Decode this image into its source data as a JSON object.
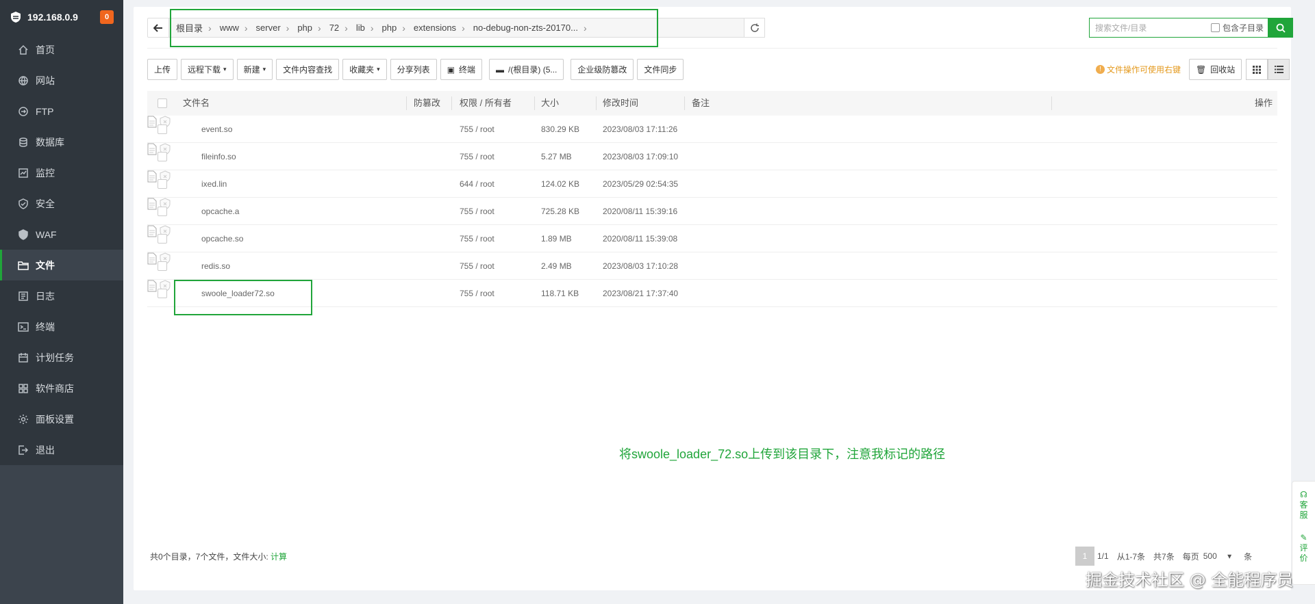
{
  "sidebar": {
    "server_ip": "192.168.0.9",
    "badge_count": "0",
    "items": [
      {
        "label": "首页"
      },
      {
        "label": "网站"
      },
      {
        "label": "FTP"
      },
      {
        "label": "数据库"
      },
      {
        "label": "监控"
      },
      {
        "label": "安全"
      },
      {
        "label": "WAF"
      },
      {
        "label": "文件"
      },
      {
        "label": "日志"
      },
      {
        "label": "终端"
      },
      {
        "label": "计划任务"
      },
      {
        "label": "软件商店"
      },
      {
        "label": "面板设置"
      },
      {
        "label": "退出"
      }
    ],
    "active": "文件"
  },
  "path": {
    "crumbs": [
      "根目录",
      "www",
      "server",
      "php",
      "72",
      "lib",
      "php",
      "extensions",
      "no-debug-non-zts-20170..."
    ]
  },
  "search": {
    "placeholder": "搜索文件/目录",
    "subdir_label": "包含子目录"
  },
  "toolbar": {
    "upload": "上传",
    "remote_download": "远程下载",
    "new": "新建",
    "content_search": "文件内容查找",
    "favorites": "收藏夹",
    "share_list": "分享列表",
    "terminal": "终端",
    "disk": "/(根目录) (5...",
    "tamper_proof": "企业级防篡改",
    "file_sync": "文件同步",
    "tip": "文件操作可使用右键",
    "recycle": "回收站"
  },
  "table": {
    "headers": {
      "name": "文件名",
      "tamper": "防篡改",
      "perm": "权限 / 所有者",
      "size": "大小",
      "mtime": "修改时间",
      "remark": "备注",
      "action": "操作"
    },
    "rows": [
      {
        "name": "event.so",
        "perm": "755 / root",
        "size": "830.29 KB",
        "mtime": "2023/08/03 17:11:26"
      },
      {
        "name": "fileinfo.so",
        "perm": "755 / root",
        "size": "5.27 MB",
        "mtime": "2023/08/03 17:09:10"
      },
      {
        "name": "ixed.lin",
        "perm": "644 / root",
        "size": "124.02 KB",
        "mtime": "2023/05/29 02:54:35"
      },
      {
        "name": "opcache.a",
        "perm": "755 / root",
        "size": "725.28 KB",
        "mtime": "2020/08/11 15:39:16"
      },
      {
        "name": "opcache.so",
        "perm": "755 / root",
        "size": "1.89 MB",
        "mtime": "2020/08/11 15:39:08"
      },
      {
        "name": "redis.so",
        "perm": "755 / root",
        "size": "2.49 MB",
        "mtime": "2023/08/03 17:10:28"
      },
      {
        "name": "swoole_loader72.so",
        "perm": "755 / root",
        "size": "118.71 KB",
        "mtime": "2023/08/21 17:37:40"
      }
    ]
  },
  "annotation": "将swoole_loader_72.so上传到该目录下，注意我标记的路径",
  "footer": {
    "summary": "共0个目录，7个文件，文件大小: ",
    "calc": "计算",
    "page_current": "1",
    "page_total": "1/1",
    "range": "从1-7条",
    "total": "共7条",
    "per_page_label": "每页",
    "per_page_value": "500",
    "unit": "条"
  },
  "float_widget": {
    "service": "客服",
    "review": "评价"
  },
  "watermark": "掘金技术社区 @ 全能程序员",
  "colors": {
    "accent": "#20a53a",
    "sidebar_bg": "#3c444d",
    "sidebar_dark": "#2f363d",
    "badge": "#f0661e",
    "tip": "#e49a1f"
  }
}
